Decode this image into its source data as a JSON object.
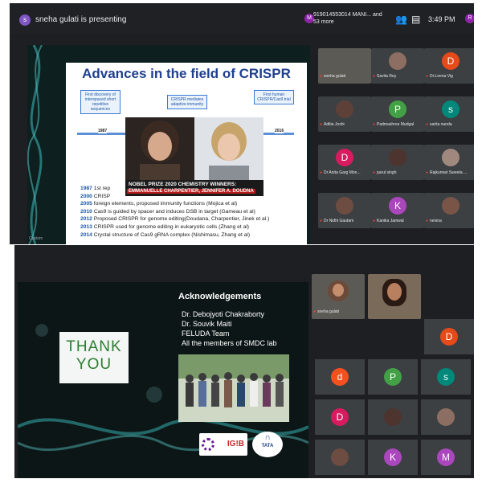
{
  "shot1": {
    "presenter_label": "sneha gulati is presenting",
    "presenter_initial": "s",
    "caller_text": "919014553014 MANI... and 53 more",
    "caller_initial": "M",
    "clock": "3:49 PM",
    "self_initial": "R",
    "slide": {
      "title": "Advances in the field of CRISPR",
      "boxes": [
        "First discovery of interspaced short repetitive sequences",
        "CRISPR mediates adaptive immunity",
        "First human CRISPR/Cas9 trial"
      ],
      "box_years": [
        "1987",
        "2016"
      ],
      "nobel_line1": "NOBEL PRIZE 2020 CHEMISTRY WINNERS:",
      "nobel_line2": "EMMANUELLE  CHARPENTIER, JENNIFER A. DOUDNA",
      "events": [
        {
          "year": "1987",
          "text": " 1st rep"
        },
        {
          "year": "2000",
          "text": " CRISP"
        },
        {
          "year": "2005",
          "text": " foreign elements, proposed immunity functions (Mojica et al)"
        },
        {
          "year": "2010",
          "text": " Cas9 is guided by spacer and induces DSB in target  (Gameau et al)"
        },
        {
          "year": "2012",
          "text": " Proposed CRISPR for genome editing(Doudana, Charpentier, Jinek et al.)"
        },
        {
          "year": "2013",
          "text": " CRISPR used for genome editing in eukaryotic cells (Zhang et al)"
        },
        {
          "year": "2014",
          "text": " Crystal structure of Cas9 gRNA complex (Nishimasu, Zhang et al)"
        }
      ],
      "stage_label": "Custom"
    },
    "participants": [
      {
        "name": "sneha gulati",
        "initial": "",
        "color": "#5c5a55",
        "photo": true,
        "self": true
      },
      {
        "name": "Savita Roy",
        "initial": "",
        "color": "#8d6e63",
        "photo": true
      },
      {
        "name": "Dr.Leena Vig",
        "initial": "D",
        "color": "#e64a19"
      },
      {
        "name": "Aditia Joshi",
        "initial": "",
        "color": "#5d4037",
        "photo": true
      },
      {
        "name": "Padmashree Mudgal",
        "initial": "P",
        "color": "#43a047"
      },
      {
        "name": "sarita nanda",
        "initial": "s",
        "color": "#00897b"
      },
      {
        "name": "Dr Anita Garg Mon...",
        "initial": "D",
        "color": "#d81b60"
      },
      {
        "name": "parul singh",
        "initial": "",
        "color": "#4e342e",
        "photo": true
      },
      {
        "name": "Rajkumari Sweeta ...",
        "initial": "",
        "color": "#a1887f",
        "photo": true
      },
      {
        "name": "Dr Nidhi Gautam",
        "initial": "",
        "color": "#6d4c41",
        "photo": true
      },
      {
        "name": "Kanika Jamwal",
        "initial": "K",
        "color": "#ab47bc"
      },
      {
        "name": "neisna",
        "initial": "",
        "color": "#795548",
        "photo": true
      }
    ]
  },
  "shot2": {
    "thank_you": [
      "THANK",
      "YOU"
    ],
    "ack_title": "Acknowledgements",
    "ack_lines": [
      "Dr. Debojyoti Chakraborty",
      "Dr. Souvik Maiti",
      "FELUDA Team",
      "All the members of SMDC lab"
    ],
    "logo_igib": "IG!B",
    "logo_tata": "TATA",
    "self_name": "sneha gulati",
    "avatars": [
      {
        "initial": "D",
        "color": "#e64a19"
      },
      {
        "initial": "d",
        "color": "#f4511e"
      },
      {
        "initial": "P",
        "color": "#43a047"
      },
      {
        "initial": "s",
        "color": "#00897b"
      },
      {
        "initial": "D",
        "color": "#d81b60"
      },
      {
        "initial": "",
        "color": "#4e342e",
        "photo": true
      },
      {
        "initial": "",
        "color": "#8d6e63",
        "photo": true
      },
      {
        "initial": "",
        "color": "#6d4c41",
        "photo": true
      },
      {
        "initial": "K",
        "color": "#ab47bc"
      },
      {
        "initial": "M",
        "color": "#ab47bc"
      }
    ]
  }
}
